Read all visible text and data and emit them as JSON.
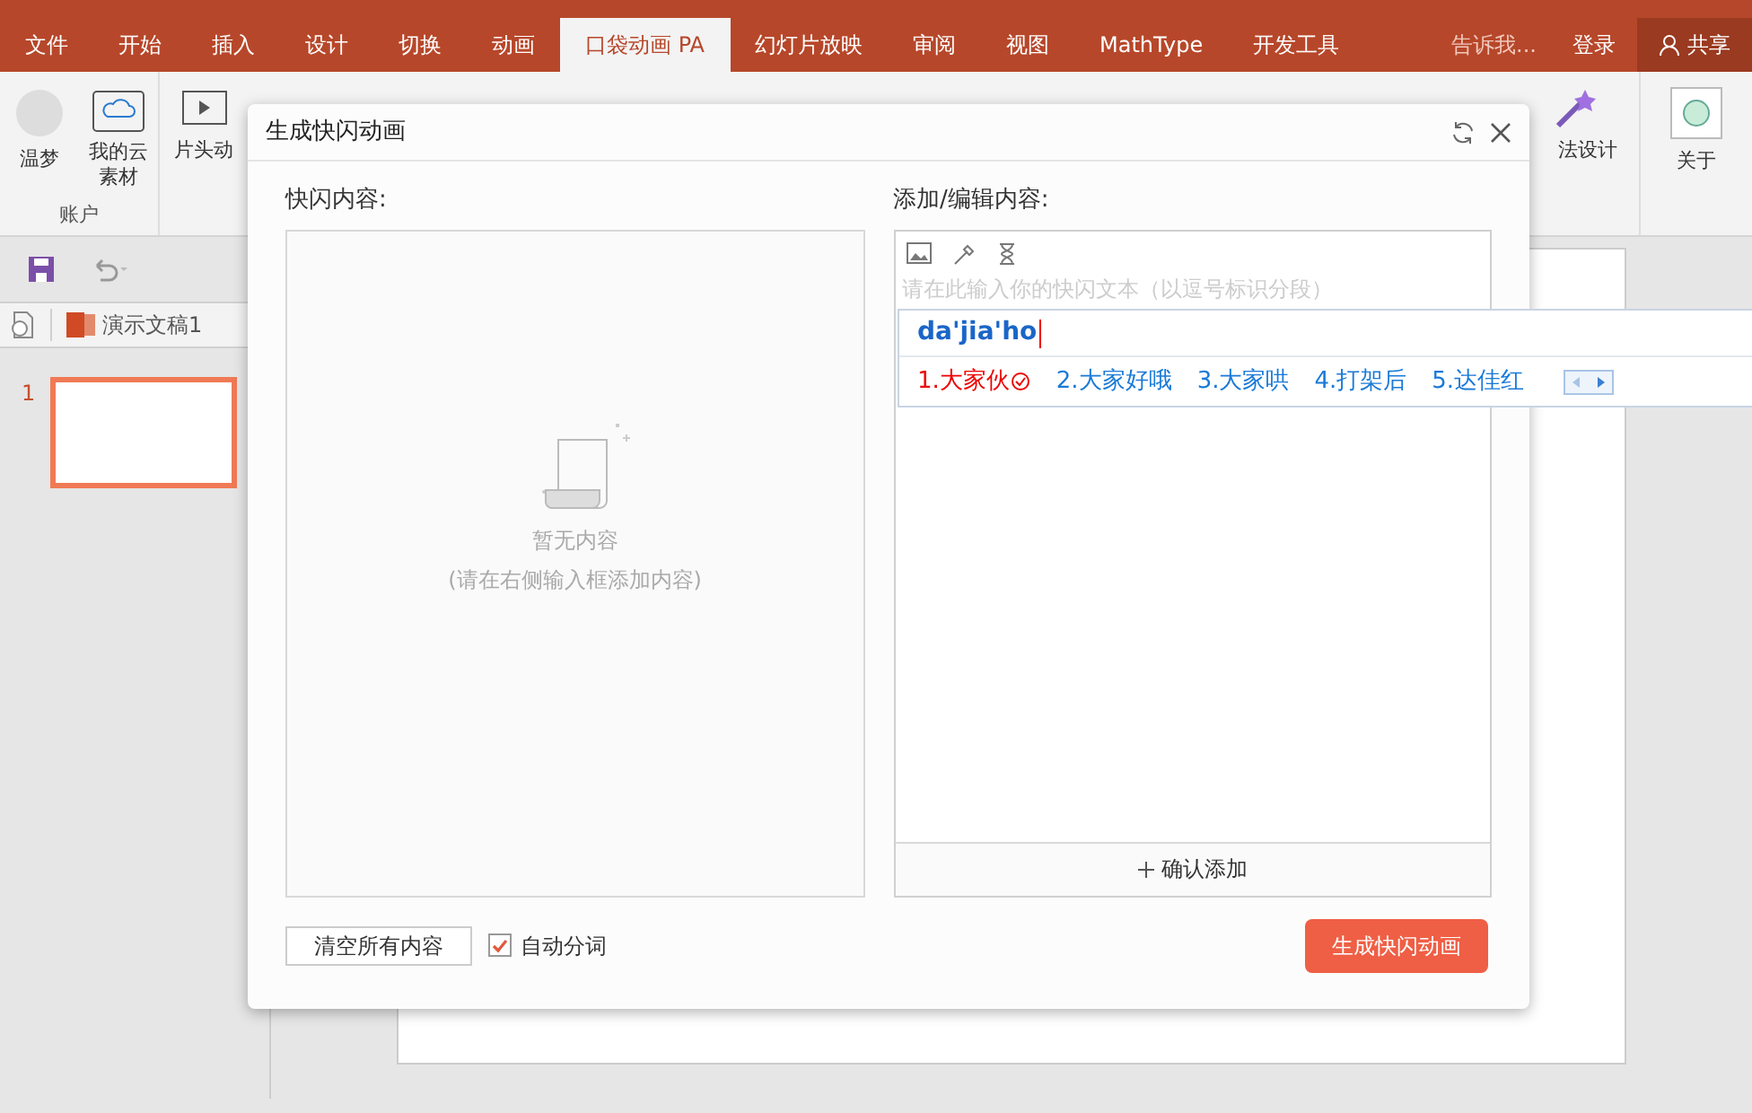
{
  "tabs": [
    {
      "label": "文件",
      "selected": false
    },
    {
      "label": "开始",
      "selected": false
    },
    {
      "label": "插入",
      "selected": false
    },
    {
      "label": "设计",
      "selected": false
    },
    {
      "label": "切换",
      "selected": false
    },
    {
      "label": "动画",
      "selected": false
    },
    {
      "label": "口袋动画 PA",
      "selected": true
    },
    {
      "label": "幻灯片放映",
      "selected": false
    },
    {
      "label": "审阅",
      "selected": false
    },
    {
      "label": "视图",
      "selected": false
    },
    {
      "label": "MathType",
      "selected": false
    },
    {
      "label": "开发工具",
      "selected": false
    }
  ],
  "tell_me": "告诉我...",
  "sign_in": "登录",
  "share": "共享",
  "ribbon": {
    "left_buttons": [
      {
        "label": "温梦"
      },
      {
        "label": "我的云素材"
      }
    ],
    "group_label": "账户",
    "cut_button": "片头动",
    "right_cut_button": "法设计",
    "about": "关于"
  },
  "document_tab": "演示文稿1",
  "slides": [
    {
      "number": "1",
      "selected": true
    }
  ],
  "dialog": {
    "title": "生成快闪动画",
    "left_label": "快闪内容:",
    "empty_title": "暂无内容",
    "empty_hint": "(请在右侧输入框添加内容)",
    "right_label": "添加/编辑内容:",
    "placeholder": "请在此输入你的快闪文本（以逗号标识分段）",
    "confirm": "确认添加",
    "clear_button": "清空所有内容",
    "auto_split": {
      "label": "自动分词",
      "checked": true
    },
    "generate_button": "生成快闪动画"
  },
  "ime": {
    "composition": "da'jia'ho",
    "candidates": [
      {
        "label": "1.大家伙",
        "selected": true
      },
      {
        "label": "2.大家好哦",
        "selected": false
      },
      {
        "label": "3.大家哄",
        "selected": false
      },
      {
        "label": "4.打架后",
        "selected": false
      },
      {
        "label": "5.达佳红",
        "selected": false
      }
    ]
  }
}
